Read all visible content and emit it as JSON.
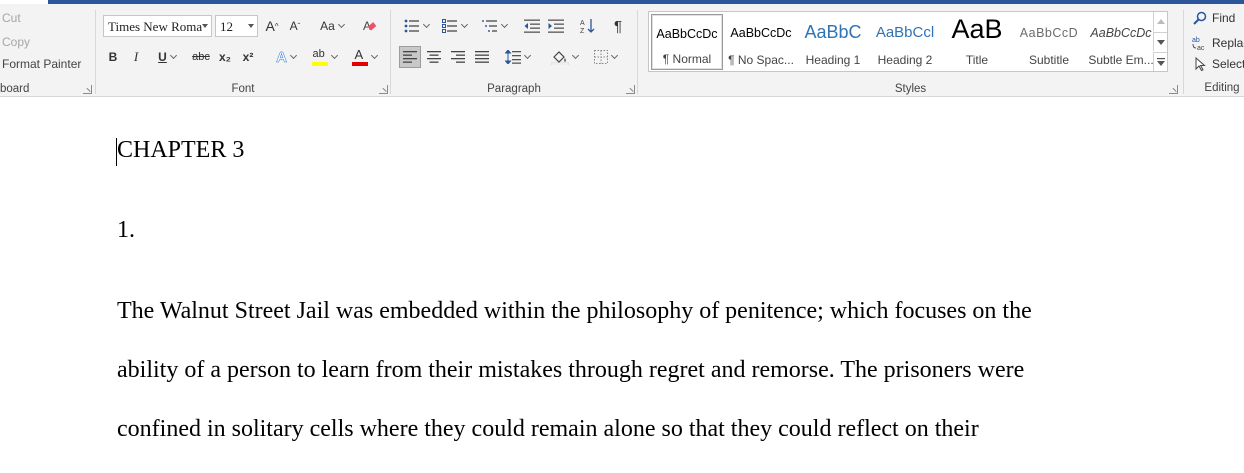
{
  "clipboard": {
    "cut_label": "Cut",
    "copy_label": "Copy",
    "format_painter_label": "Format Painter",
    "group_label": "board"
  },
  "font": {
    "family_value": "Times New Roma",
    "size_value": "12",
    "grow_label": "A",
    "shrink_label": "A",
    "case_label": "Aa",
    "bold_label": "B",
    "italic_label": "I",
    "underline_label": "U",
    "strike_label": "abc",
    "subscript_label": "x₂",
    "superscript_label": "x²",
    "effects_label": "A",
    "highlight_label": "ab",
    "font_color_label": "A",
    "group_label": "Font",
    "highlight_color": "#ffff00",
    "font_color": "#e00000"
  },
  "paragraph": {
    "group_label": "Paragraph",
    "pilcrow_label": "¶"
  },
  "styles": {
    "group_label": "Styles",
    "items": [
      {
        "sample": "AaBbCcDc",
        "name": "¶ Normal"
      },
      {
        "sample": "AaBbCcDc",
        "name": "¶ No Spac..."
      },
      {
        "sample": "AaBbC",
        "name": "Heading 1"
      },
      {
        "sample": "AaBbCcl",
        "name": "Heading 2"
      },
      {
        "sample": "AaB",
        "name": "Title"
      },
      {
        "sample": "AaBbCcD",
        "name": "Subtitle"
      },
      {
        "sample": "AaBbCcDc",
        "name": "Subtle Em..."
      }
    ]
  },
  "editing": {
    "group_label": "Editing",
    "find_label": "Find",
    "replace_label": "Replac",
    "select_label": "Select"
  },
  "document": {
    "heading": "CHAPTER 3",
    "list_number": "1.",
    "lines": [
      "The Walnut Street Jail was embedded within the philosophy of penitence; which focuses on the",
      "ability of a person to learn from their mistakes through regret and remorse. The prisoners were",
      "confined in solitary cells where they could remain alone so that they could reflect on their"
    ]
  },
  "colors": {
    "accent": "#2b579a",
    "heading_style": "#2e74b5"
  }
}
